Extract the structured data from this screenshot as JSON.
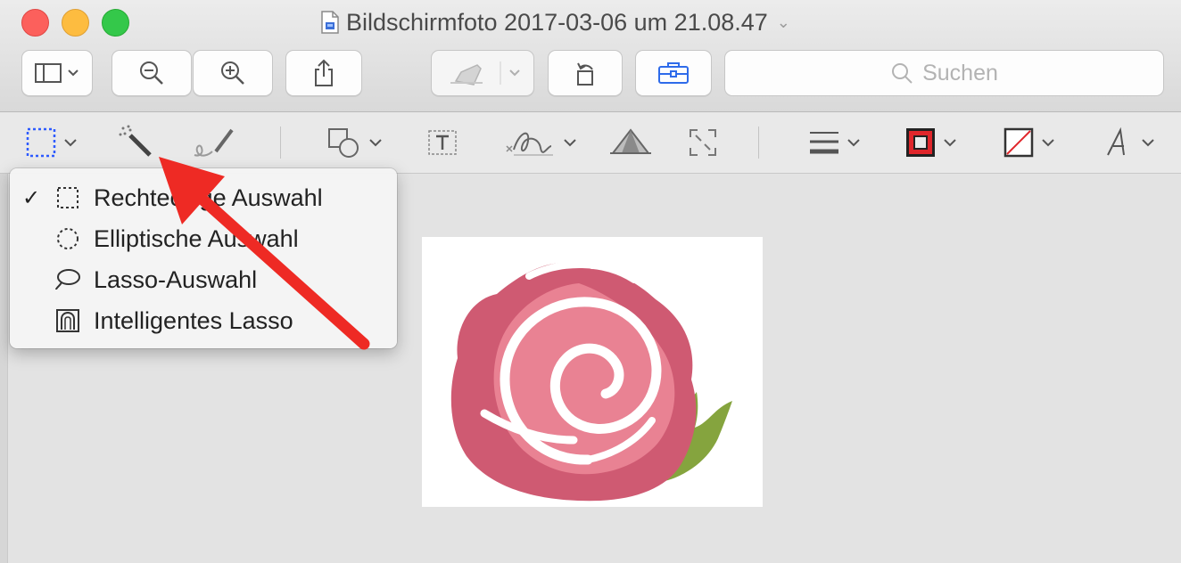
{
  "window": {
    "title": "Bildschirmfoto 2017-03-06 um 21.08.47",
    "title_icon": "document-icon",
    "title_chevron": "⌄",
    "traffic_lights": {
      "close": "#fc605c",
      "minimize": "#fdbc40",
      "zoom": "#34c84a"
    }
  },
  "toolbar": {
    "buttons": [
      {
        "name": "sidebar-view-button",
        "icon": "sidebar-icon",
        "has_dropdown": true
      },
      {
        "name": "zoom-out-button",
        "icon": "zoom-out-icon"
      },
      {
        "name": "zoom-in-button",
        "icon": "zoom-in-icon"
      },
      {
        "name": "share-button",
        "icon": "share-icon"
      },
      {
        "name": "highlight-button",
        "icon": "highlighter-icon",
        "has_dropdown": true,
        "disabled": true
      },
      {
        "name": "rotate-button",
        "icon": "rotate-icon"
      },
      {
        "name": "markup-toolbox-button",
        "icon": "toolbox-icon",
        "active": true
      }
    ],
    "search_placeholder": "Suchen"
  },
  "markup_bar": {
    "tools": [
      "rectangular-selection-icon",
      "instant-alpha-icon",
      "sketch-icon",
      "shapes-icon",
      "text-icon",
      "signature-icon",
      "adjust-color-icon",
      "adjust-size-icon",
      "line-style-icon",
      "border-color-icon",
      "fill-color-icon",
      "text-style-icon"
    ],
    "accent_color": "#2e5bff",
    "border_color": "#e0262b"
  },
  "selection_menu": {
    "items": [
      {
        "label": "Rechteckige Auswahl",
        "icon": "rectangle-selection-icon",
        "checked": true
      },
      {
        "label": "Elliptische Auswahl",
        "icon": "ellipse-selection-icon",
        "checked": false
      },
      {
        "label": "Lasso-Auswahl",
        "icon": "lasso-icon",
        "checked": false
      },
      {
        "label": "Intelligentes Lasso",
        "icon": "smart-lasso-icon",
        "checked": false
      }
    ],
    "check_mark": "✓"
  },
  "annotation": {
    "arrow_color": "#ee2a24"
  },
  "document_image": {
    "subject": "rose-icon"
  }
}
